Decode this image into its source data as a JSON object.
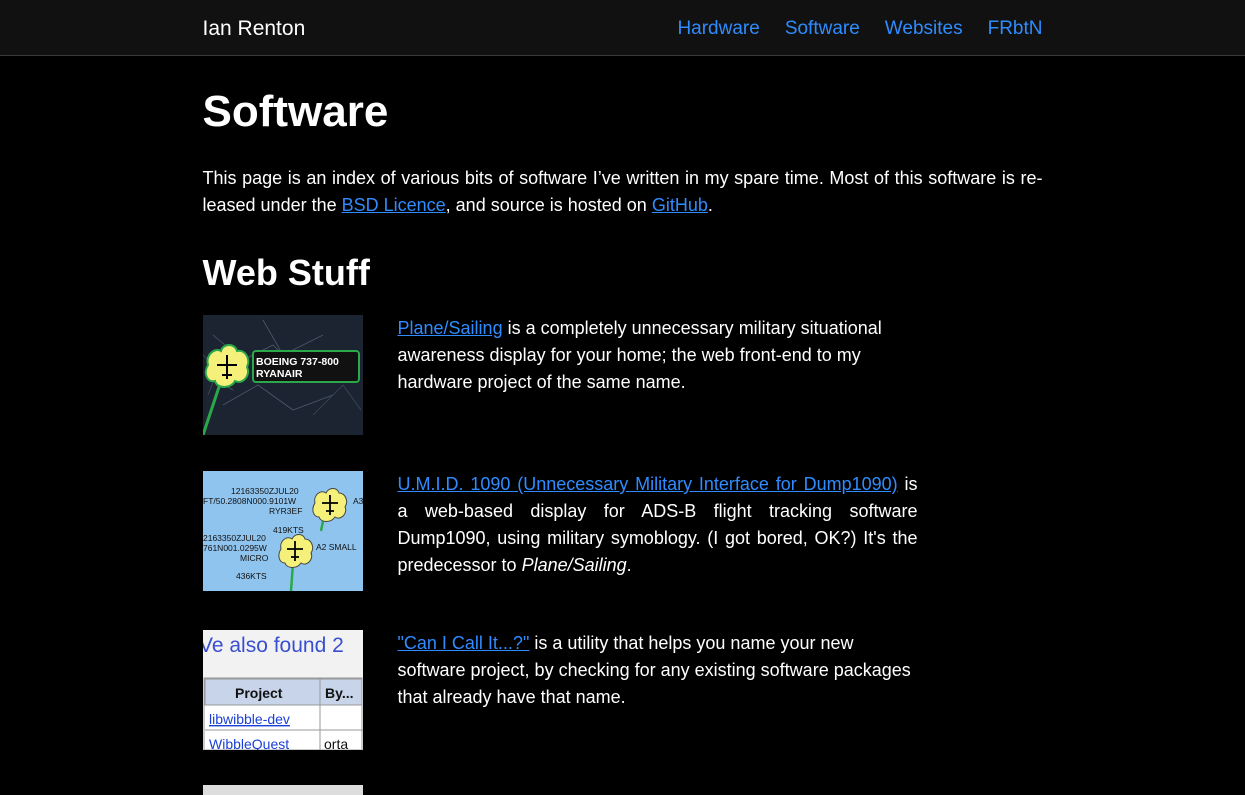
{
  "header": {
    "site_title": "Ian Renton",
    "nav": [
      "Hardware",
      "Software",
      "Websites",
      "FRbtN"
    ]
  },
  "page": {
    "title": "Software",
    "intro_before": "This page is an index of various bits of software I’ve written in my spare time. Most of this software is re-leased under the ",
    "intro_link1": "BSD Licence",
    "intro_middle": ", and source is hosted on ",
    "intro_link2": "GitHub",
    "intro_after": "."
  },
  "web_stuff": {
    "heading": "Web Stuff",
    "items": [
      {
        "link": "Plane/Sailing",
        "text": " is a completely unnecessary military situational awareness display for your home; the web front-end to my hardware project of the same name.",
        "thumb": {
          "callsign_line1": "BOEING 737-800",
          "callsign_line2": "RYANAIR"
        }
      },
      {
        "link": "U.M.I.D. 1090 (Unnecessary Military Interface for Dump1090)",
        "text_before": " is a web-based display for ADS-B flight tracking software Dump1090, using military symoblogy. (I got bored, OK?) It's the predecessor to ",
        "italic": "Plane/Sailing",
        "text_after": ".",
        "thumb": {
          "lines_a": [
            "12163350ZJUL20",
            "FT/50.2808N000.9101W",
            "RYR3EF",
            "419KTS"
          ],
          "label_a": "A3",
          "lines_b": [
            "2163350ZJUL20",
            "761N001.0295W",
            "MICRO",
            "436KTS"
          ],
          "label_b": "A2 SMALL"
        }
      },
      {
        "link": "\"Can I Call It...?\"",
        "text": " is a utility that helps you name your new software project, by checking for any existing software packages that already have that name.",
        "thumb": {
          "banner": "Ve also found 2",
          "col1": "Project",
          "col2": "By...",
          "row1": "libwibble-dev",
          "row2": "WibbleQuest",
          "row2b": "orta"
        }
      }
    ]
  },
  "colors": {
    "accent": "#2f8cff",
    "background": "#000000",
    "topbar": "#111111"
  }
}
